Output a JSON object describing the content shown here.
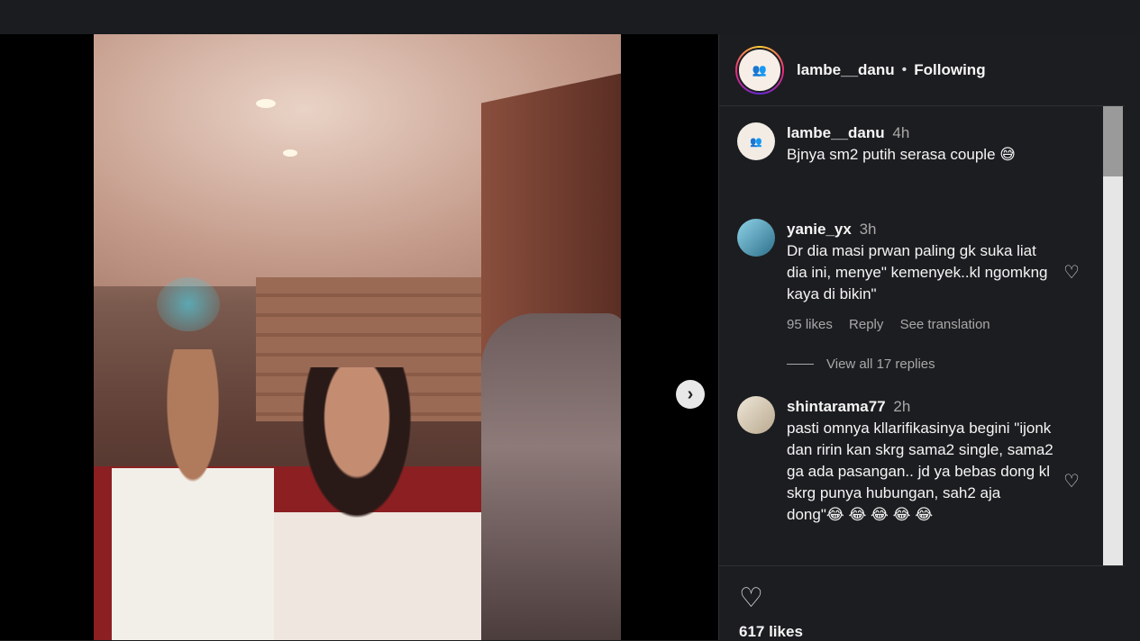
{
  "post": {
    "username": "lambe__danu",
    "follow_status": "Following",
    "likes_count": "617 likes"
  },
  "comments": [
    {
      "user": "lambe__danu",
      "time": "4h",
      "text": "Bjnya sm2 putih serasa couple 😅"
    },
    {
      "user": "yanie_yx",
      "time": "3h",
      "text": "Dr dia masi prwan paling gk suka liat dia ini, menye\" kemenyek..kl ngomkng kaya di bikin\"",
      "likes": "95 likes",
      "reply": "Reply",
      "see_translation": "See translation",
      "replies_label": "View all 17 replies"
    },
    {
      "user": "shintarama77",
      "time": "2h",
      "text": "pasti omnya kllarifikasinya begini \"ijonk dan ririn kan skrg sama2 single, sama2 ga ada pasangan.. jd ya bebas dong kl skrg punya hubungan, sah2 aja dong\"😂 😂 😂 😂 😂"
    }
  ],
  "icons": {
    "next": "chevron-right-icon",
    "heart": "heart-outline-icon"
  },
  "colors": {
    "background": "#1c1d20",
    "text": "#f5f5f5",
    "muted": "#a8a8a8"
  }
}
